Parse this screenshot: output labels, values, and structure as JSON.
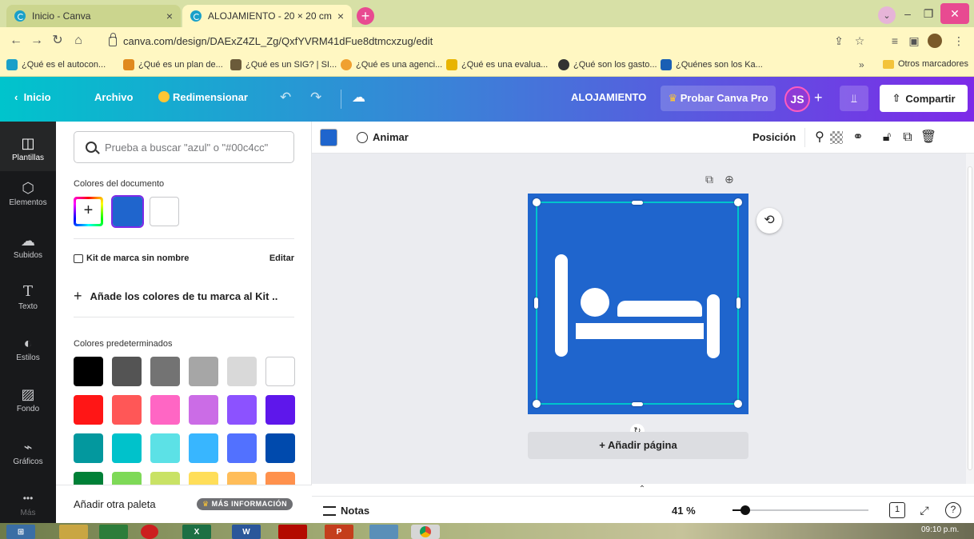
{
  "browser": {
    "tabs": [
      {
        "title": "Inicio - Canva",
        "active": false
      },
      {
        "title": "ALOJAMIENTO - 20 × 20 cm",
        "active": true
      }
    ],
    "url": "canva.com/design/DAExZ4ZL_Zg/QxfYVRM41dFue8dtmcxzug/edit",
    "bookmarks": [
      {
        "label": "¿Qué es el autocon...",
        "color": "#1aa0c9"
      },
      {
        "label": "¿Qué es un plan de...",
        "color": "#e08a1e"
      },
      {
        "label": "¿Qué es un SIG? | SI...",
        "color": "#6b5b3a"
      },
      {
        "label": "¿Qué es una agenci...",
        "color": "#f0a030"
      },
      {
        "label": "¿Qué es una evalua...",
        "color": "#e8b400"
      },
      {
        "label": "¿Qué son los gasto...",
        "color": "#333333"
      },
      {
        "label": "¿Quénes son los Ka...",
        "color": "#1a5fb4"
      }
    ],
    "bookmarks_more": "»",
    "other_bookmarks": "Otros marcadores"
  },
  "canva_bar": {
    "home": "Inicio",
    "file": "Archivo",
    "resize": "Redimensionar",
    "title": "ALOJAMIENTO",
    "try_pro": "Probar Canva Pro",
    "avatar_initials": "JS",
    "share": "Compartir"
  },
  "rail": [
    {
      "label": "Plantillas",
      "icon": "templates-icon",
      "glyph": "◫"
    },
    {
      "label": "Elementos",
      "icon": "elements-icon",
      "glyph": "⬡"
    },
    {
      "label": "Subidos",
      "icon": "upload-cloud-icon",
      "glyph": "☁"
    },
    {
      "label": "Texto",
      "icon": "text-icon",
      "glyph": "T"
    },
    {
      "label": "Estilos",
      "icon": "palette-icon",
      "glyph": "◐"
    },
    {
      "label": "Fondo",
      "icon": "background-icon",
      "glyph": "▨"
    },
    {
      "label": "Gráficos",
      "icon": "chart-icon",
      "glyph": "⌁"
    },
    {
      "label": "Más",
      "icon": "more-icon",
      "glyph": "•••"
    }
  ],
  "panel": {
    "search_placeholder": "Prueba a buscar \"azul\" o \"#00c4cc\"",
    "doc_colors_title": "Colores del documento",
    "doc_colors": [
      "#1f65cd",
      "#ffffff"
    ],
    "brand_kit": "Kit de marca sin nombre",
    "edit": "Editar",
    "add_brand_colors": "Añade los colores de tu marca al Kit ..",
    "default_colors_title": "Colores predeterminados",
    "default_colors": [
      "#000000",
      "#545454",
      "#737373",
      "#a6a6a6",
      "#d9d9d9",
      "#ffffff",
      "#ff1616",
      "#ff5757",
      "#ff66c4",
      "#cb6ce6",
      "#8c52ff",
      "#5e17eb",
      "#03989e",
      "#00c2cb",
      "#5ce1e6",
      "#38b6ff",
      "#5271ff",
      "#004aad",
      "#008037",
      "#7ed957",
      "#c9e265",
      "#ffde59",
      "#ffbd59",
      "#ff914d"
    ],
    "footer_label": "Añadir otra paleta",
    "more_info": "MÁS INFORMACIÓN"
  },
  "toolbar": {
    "selected_color": "#1f65cd",
    "animate": "Animar",
    "position": "Posición"
  },
  "canvas": {
    "design_bg": "#1f65cd",
    "add_page": "+ Añadir página"
  },
  "footer": {
    "notes": "Notas",
    "zoom": "41 %",
    "zoom_level_percent": 41,
    "page_count": "1",
    "help": "?"
  },
  "taskbar": {
    "clock": "09:10 p.m."
  }
}
